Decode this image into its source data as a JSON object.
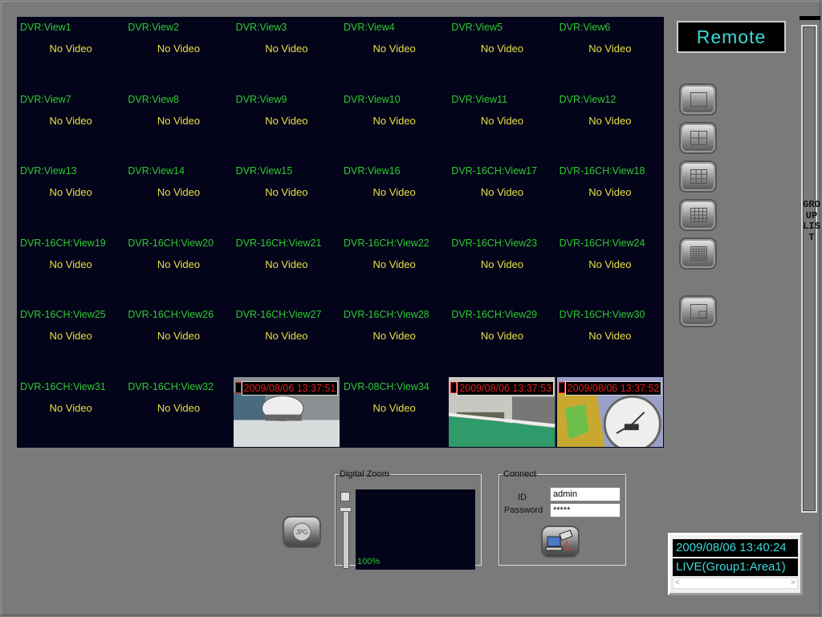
{
  "grid": {
    "no_video_text": "No Video",
    "cells": [
      {
        "label": "DVR:View1"
      },
      {
        "label": "DVR:View2"
      },
      {
        "label": "DVR:View3"
      },
      {
        "label": "DVR:View4"
      },
      {
        "label": "DVR:View5"
      },
      {
        "label": "DVR:View6"
      },
      {
        "label": "DVR:View7"
      },
      {
        "label": "DVR:View8"
      },
      {
        "label": "DVR:View9"
      },
      {
        "label": "DVR:View10"
      },
      {
        "label": "DVR:View11"
      },
      {
        "label": "DVR:View12"
      },
      {
        "label": "DVR:View13"
      },
      {
        "label": "DVR:View14"
      },
      {
        "label": "DVR:View15"
      },
      {
        "label": "DVR:View16"
      },
      {
        "label": "DVR-16CH:View17"
      },
      {
        "label": "DVR-16CH:View18"
      },
      {
        "label": "DVR-16CH:View19"
      },
      {
        "label": "DVR-16CH:View20"
      },
      {
        "label": "DVR-16CH:View21"
      },
      {
        "label": "DVR-16CH:View22"
      },
      {
        "label": "DVR-16CH:View23"
      },
      {
        "label": "DVR-16CH:View24"
      },
      {
        "label": "DVR-16CH:View25"
      },
      {
        "label": "DVR-16CH:View26"
      },
      {
        "label": "DVR-16CH:View27"
      },
      {
        "label": "DVR-16CH:View28"
      },
      {
        "label": "DVR-16CH:View29"
      },
      {
        "label": "DVR-16CH:View30"
      },
      {
        "label": "DVR-16CH:View31"
      },
      {
        "label": "DVR-16CH:View32"
      },
      {
        "timestamp": "2009/08/06 13:37:51",
        "scene": "clock-desk"
      },
      {
        "label": "DVR-08CH:View34"
      },
      {
        "timestamp": "2009/08/06 13:37:53",
        "scene": "office"
      },
      {
        "timestamp": "2009/08/06 13:37:52",
        "scene": "clock-figure"
      }
    ]
  },
  "mode_label": "Remote",
  "layout_buttons": [
    {
      "icon": "layout-1x1-icon"
    },
    {
      "icon": "layout-2x2-icon"
    },
    {
      "icon": "layout-3x3-icon"
    },
    {
      "icon": "layout-4x4-icon"
    },
    {
      "icon": "layout-6x6-icon"
    },
    {
      "icon": "layout-pip-icon"
    }
  ],
  "group_list_label": "GROUP LIST",
  "digital_zoom": {
    "title": "Digital Zoom",
    "zoom_text": "100%"
  },
  "connect": {
    "title": "Connect",
    "id_label": "ID",
    "password_label": "Password",
    "id_value": "admin",
    "password_value": "*****"
  },
  "status": {
    "datetime": "2009/08/06 13:40:24",
    "mode": "LIVE(Group1:Area1)"
  },
  "colors": {
    "label": "#2ecc2e",
    "no_video": "#e8e040",
    "timestamp": "#e02020",
    "remote": "#3ad8d8"
  }
}
